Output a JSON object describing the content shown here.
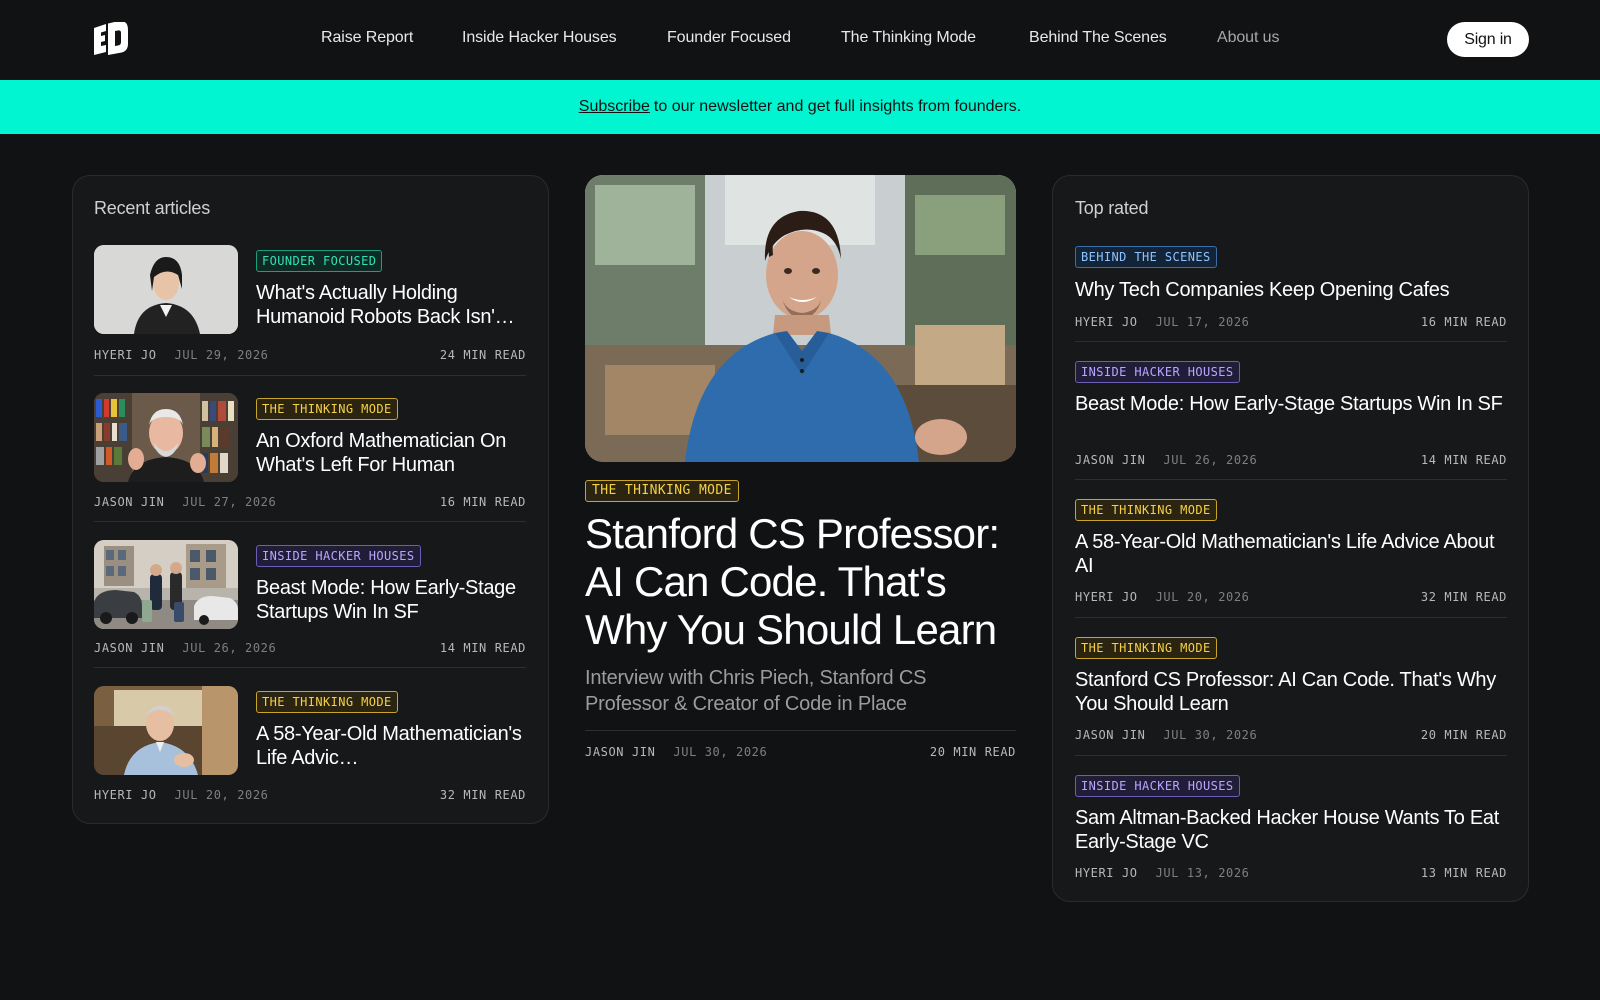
{
  "brand": {
    "logo_icon": "ed-logo-icon"
  },
  "nav": {
    "items": [
      {
        "label": "Raise Report"
      },
      {
        "label": "Inside Hacker Houses"
      },
      {
        "label": "Founder Focused"
      },
      {
        "label": "The Thinking Mode"
      },
      {
        "label": "Behind The Scenes"
      },
      {
        "label": "About us"
      }
    ],
    "sign_in": "Sign in"
  },
  "banner": {
    "link": "Subscribe",
    "text": "to our newsletter and get full insights from founders.",
    "color": "#00f5d0"
  },
  "recent": {
    "title": "Recent articles",
    "items": [
      {
        "tag": "FOUNDER FOCUSED",
        "title": "What's Actually Holding Humanoid Robots Back Isn'…",
        "author": "HYERI JO",
        "date": "JUL 29, 2026",
        "read": "24 MIN READ"
      },
      {
        "tag": "THE THINKING MODE",
        "title": "An Oxford Mathematician On What's Left For Human",
        "author": "JASON JIN",
        "date": "JUL 27, 2026",
        "read": "16 MIN READ"
      },
      {
        "tag": "INSIDE HACKER HOUSES",
        "title": "Beast Mode: How Early-Stage Startups Win In SF",
        "author": "JASON JIN",
        "date": "JUL 26, 2026",
        "read": "14 MIN READ"
      },
      {
        "tag": "THE THINKING MODE",
        "title": "A 58-Year-Old Mathematician's Life Advic…",
        "author": "HYERI JO",
        "date": "JUL 20, 2026",
        "read": "32 MIN READ"
      }
    ]
  },
  "featured": {
    "tag": "THE THINKING MODE",
    "title": "Stanford CS Professor: AI Can Code. That's Why You Should Learn",
    "subtitle": "Interview with Chris Piech, Stanford CS Professor & Creator of Code in Place",
    "author": "JASON JIN",
    "date": "JUL 30, 2026",
    "read": "20 MIN READ"
  },
  "top": {
    "title": "Top rated",
    "items": [
      {
        "tag": "BEHIND THE SCENES",
        "title": "Why Tech Companies Keep Opening Cafes",
        "author": "HYERI JO",
        "date": "JUL 17, 2026",
        "read": "16 MIN READ"
      },
      {
        "tag": "INSIDE HACKER HOUSES",
        "title": "Beast Mode: How Early-Stage Startups Win In SF",
        "author": "JASON JIN",
        "date": "JUL 26, 2026",
        "read": "14 MIN READ"
      },
      {
        "tag": "THE THINKING MODE",
        "title": "A 58-Year-Old Mathematician's Life Advice About AI",
        "author": "HYERI JO",
        "date": "JUL 20, 2026",
        "read": "32 MIN READ"
      },
      {
        "tag": "THE THINKING MODE",
        "title": "Stanford CS Professor: AI Can Code. That's Why You Should Learn",
        "author": "JASON JIN",
        "date": "JUL 30, 2026",
        "read": "20 MIN READ"
      },
      {
        "tag": "INSIDE HACKER HOUSES",
        "title": "Sam Altman-Backed Hacker House Wants To Eat Early-Stage VC",
        "author": "HYERI JO",
        "date": "JUL 13, 2026",
        "read": "13 MIN READ"
      }
    ]
  }
}
